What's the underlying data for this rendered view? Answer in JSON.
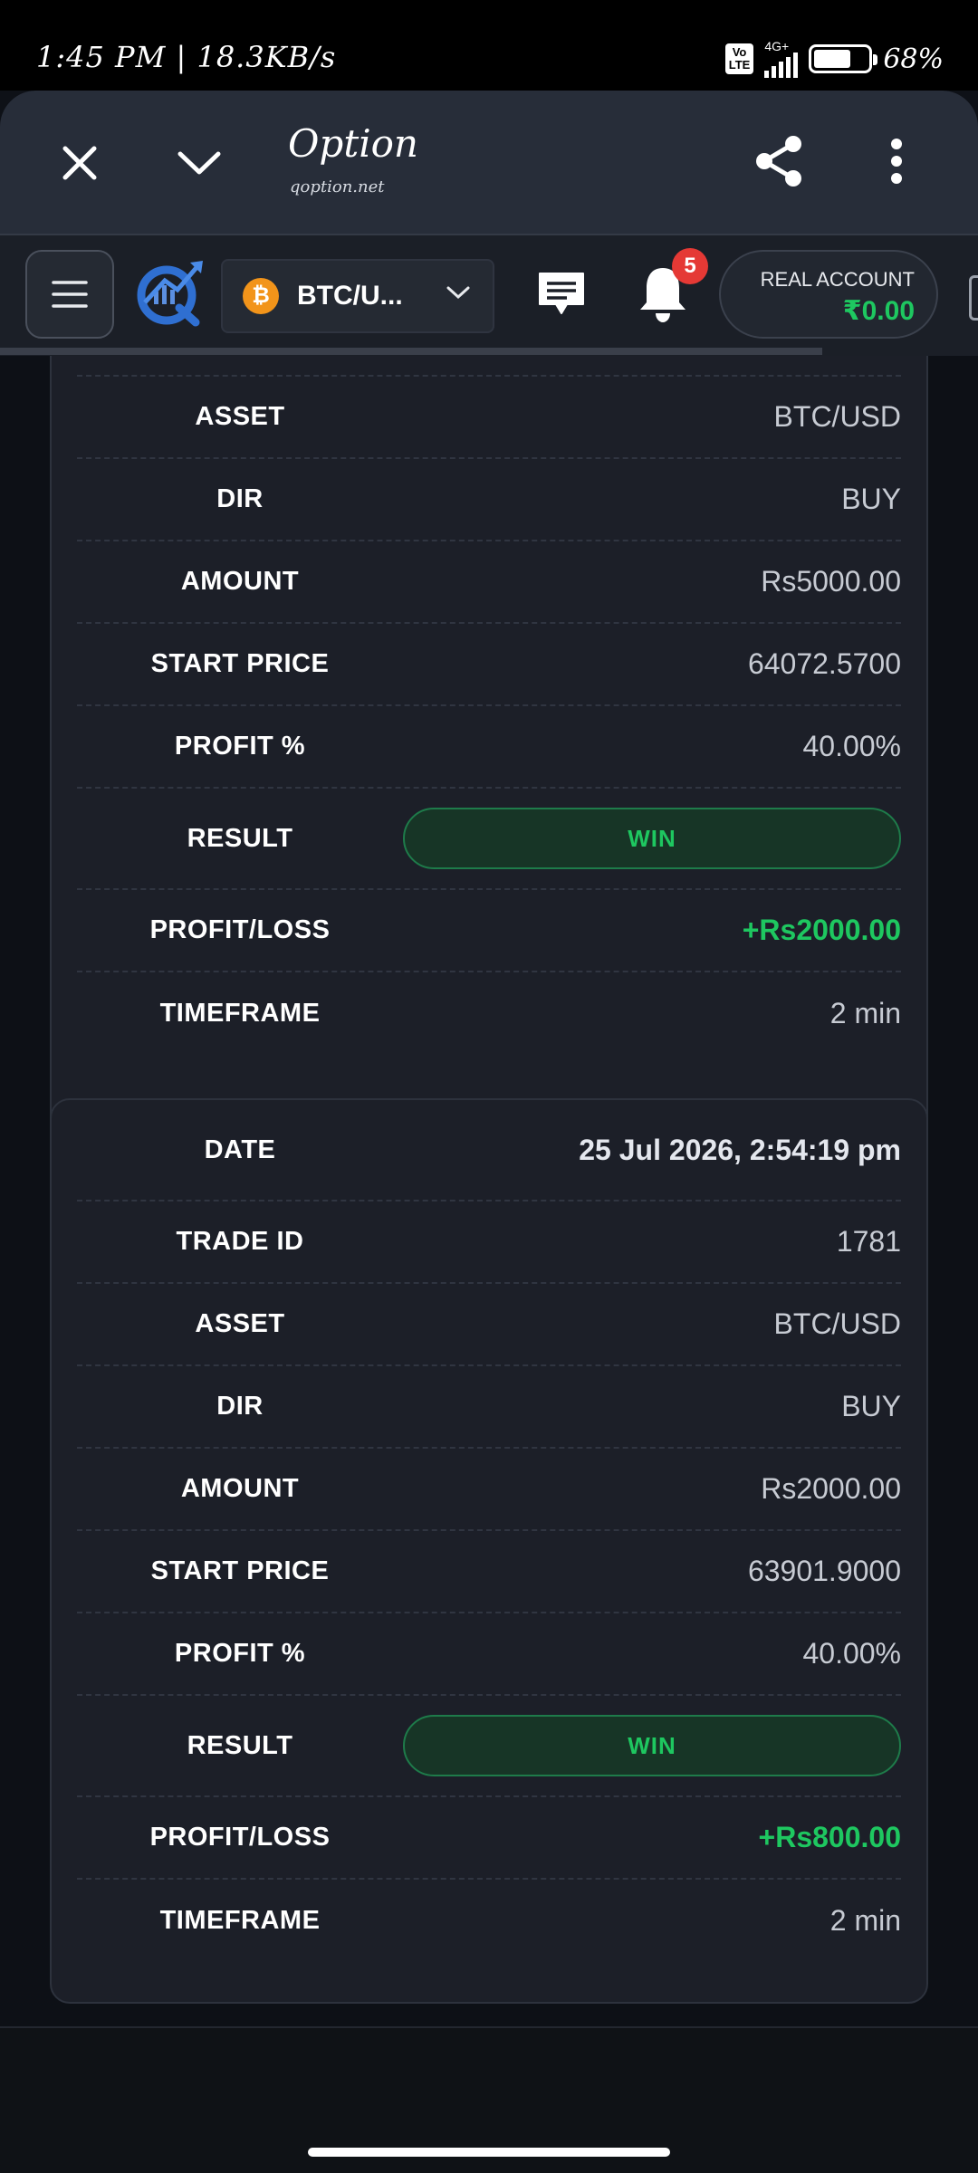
{
  "status_bar": {
    "time_speed": "1:45 PM | 18.3KB/s",
    "volte": "Vo\nLTE",
    "network": "4G+",
    "battery": "68%",
    "battery_level": 0.68
  },
  "browser": {
    "site_title": "Option",
    "site_url": "qoption.net"
  },
  "header": {
    "pair": "BTC/U...",
    "btc_symbol": "₿",
    "notifications": "5",
    "account_label": "REAL ACCOUNT",
    "account_balance": "₹0.00"
  },
  "trades": [
    {
      "rows": [
        {
          "label": "ASSET",
          "value": "BTC/USD"
        },
        {
          "label": "DIR",
          "value": "BUY"
        },
        {
          "label": "AMOUNT",
          "value": "Rs5000.00"
        },
        {
          "label": "START PRICE",
          "value": "64072.5700"
        },
        {
          "label": "PROFIT %",
          "value": "40.00%"
        }
      ],
      "result_label": "RESULT",
      "result": "WIN",
      "pl_label": "PROFIT/LOSS",
      "pl": "+Rs2000.00",
      "timeframe_label": "TIMEFRAME",
      "timeframe": "2 min"
    },
    {
      "date_label": "DATE",
      "date": "25 Jul 2026, 2:54:19 pm",
      "rows": [
        {
          "label": "TRADE ID",
          "value": "1781"
        },
        {
          "label": "ASSET",
          "value": "BTC/USD"
        },
        {
          "label": "DIR",
          "value": "BUY"
        },
        {
          "label": "AMOUNT",
          "value": "Rs2000.00"
        },
        {
          "label": "START PRICE",
          "value": "63901.9000"
        },
        {
          "label": "PROFIT %",
          "value": "40.00%"
        }
      ],
      "result_label": "RESULT",
      "result": "WIN",
      "pl_label": "PROFIT/LOSS",
      "pl": "+Rs800.00",
      "timeframe_label": "TIMEFRAME",
      "timeframe": "2 min"
    }
  ],
  "colors": {
    "accent_green": "#1ec760",
    "background": "#0d1016",
    "card": "#1c1f28",
    "badge_red": "#e53935",
    "btc_orange": "#f2941a"
  }
}
